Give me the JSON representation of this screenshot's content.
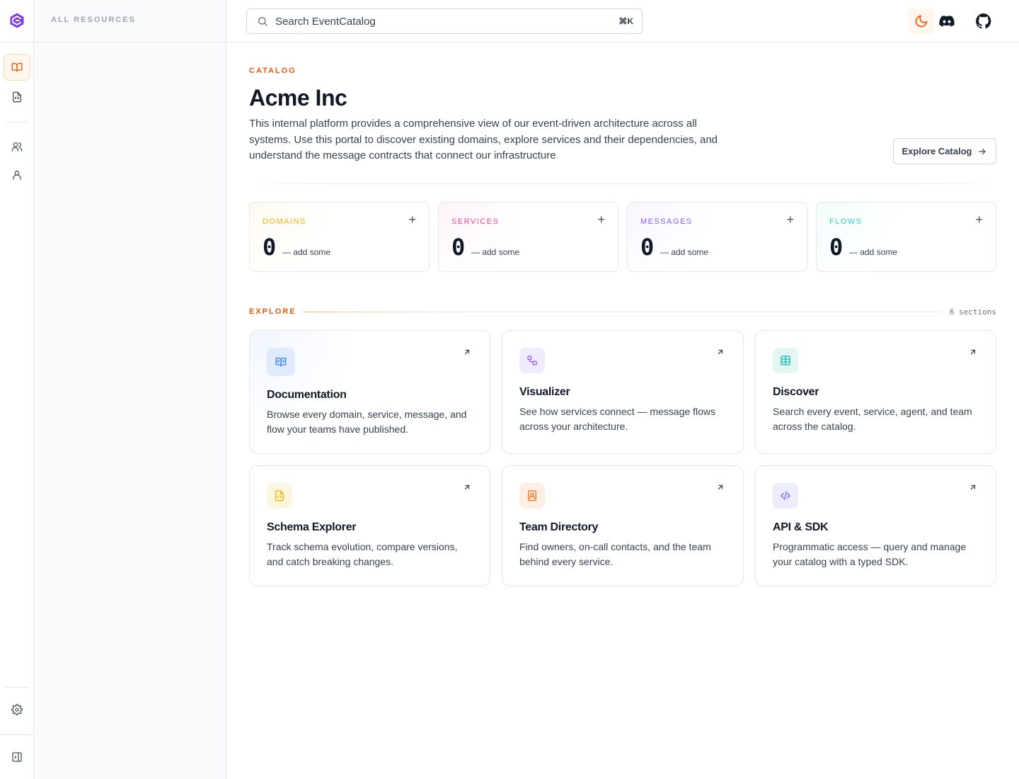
{
  "sidebar": {
    "header": "ALL RESOURCES"
  },
  "search": {
    "placeholder": "Search EventCatalog",
    "shortcut": "⌘K"
  },
  "page": {
    "eyebrow": "CATALOG",
    "title": "Acme Inc",
    "description": "This internal platform provides a comprehensive view of our event-driven architecture across all systems. Use this portal to discover existing domains, explore services and their dependencies, and understand the message contracts that connect our infrastructure",
    "cta": "Explore Catalog"
  },
  "stats": [
    {
      "label": "DOMAINS",
      "value": "0",
      "hint": "— add some",
      "color": "#eab308"
    },
    {
      "label": "SERVICES",
      "value": "0",
      "hint": "— add some",
      "color": "#ec4899"
    },
    {
      "label": "MESSAGES",
      "value": "0",
      "hint": "— add some",
      "color": "#8b5cf6"
    },
    {
      "label": "FLOWS",
      "value": "0",
      "hint": "— add some",
      "color": "#2dd4bf"
    }
  ],
  "explore": {
    "label": "EXPLORE",
    "count": "6 sections",
    "cards": [
      {
        "title": "Documentation",
        "desc": "Browse every domain, service, message, and flow your teams have published.",
        "icon": "book-open-icon",
        "color": "#3b82f6"
      },
      {
        "title": "Visualizer",
        "desc": "See how services connect — message flows across your architecture.",
        "icon": "workflow-icon",
        "color": "#8b5cf6"
      },
      {
        "title": "Discover",
        "desc": "Search every event, service, agent, and team across the catalog.",
        "icon": "table-icon",
        "color": "#14b8a6"
      },
      {
        "title": "Schema Explorer",
        "desc": "Track schema evolution, compare versions, and catch breaking changes.",
        "icon": "file-code-icon",
        "color": "#eab308"
      },
      {
        "title": "Team Directory",
        "desc": "Find owners, on-call contacts, and the team behind every service.",
        "icon": "contact-book-icon",
        "color": "#f97316"
      },
      {
        "title": "API & SDK",
        "desc": "Programmatic access — query and manage your catalog with a typed SDK.",
        "icon": "code-icon",
        "color": "#6366f1"
      }
    ]
  }
}
